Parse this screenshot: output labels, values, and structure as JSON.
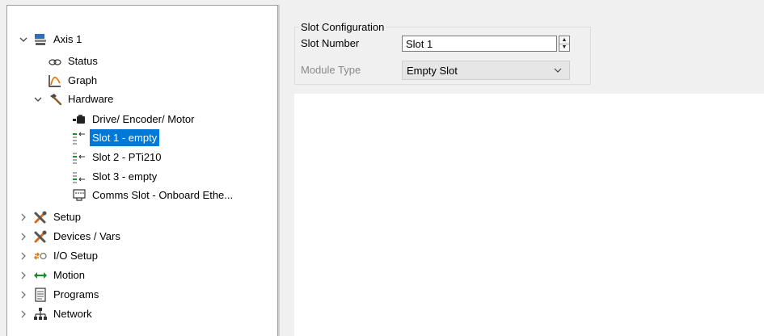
{
  "tree": {
    "items": [
      {
        "label": "Axis 1",
        "icon": "axis-drive-icon",
        "expanded": true
      },
      {
        "label": "Status",
        "icon": "status-link-icon"
      },
      {
        "label": "Graph",
        "icon": "graph-icon"
      },
      {
        "label": "Hardware",
        "icon": "hammer-icon",
        "expanded": true
      },
      {
        "label": "Drive/ Encoder/ Motor",
        "icon": "motor-icon"
      },
      {
        "label": "Slot 1 - empty",
        "icon": "slot-icon",
        "selected": true
      },
      {
        "label": "Slot 2 - PTi210",
        "icon": "slot-icon"
      },
      {
        "label": "Slot 3 - empty",
        "icon": "slot-icon"
      },
      {
        "label": "Comms Slot - Onboard Ethe...",
        "icon": "ethernet-port-icon"
      },
      {
        "label": "Setup",
        "icon": "tools-icon",
        "expanded": false
      },
      {
        "label": "Devices / Vars",
        "icon": "tools-icon",
        "expanded": false
      },
      {
        "label": "I/O Setup",
        "icon": "io-icon",
        "expanded": false
      },
      {
        "label": "Motion",
        "icon": "double-arrow-icon",
        "expanded": false
      },
      {
        "label": "Programs",
        "icon": "document-icon",
        "expanded": false
      },
      {
        "label": "Network",
        "icon": "network-icon",
        "expanded": false
      }
    ]
  },
  "slot_config": {
    "title": "Slot Configuration",
    "slot_number_label": "Slot Number",
    "slot_number_value": "Slot 1",
    "module_type_label": "Module Type",
    "module_type_value": "Empty Slot"
  },
  "colors": {
    "selection": "#0078d7",
    "window_bg": "#f0f0f0"
  }
}
